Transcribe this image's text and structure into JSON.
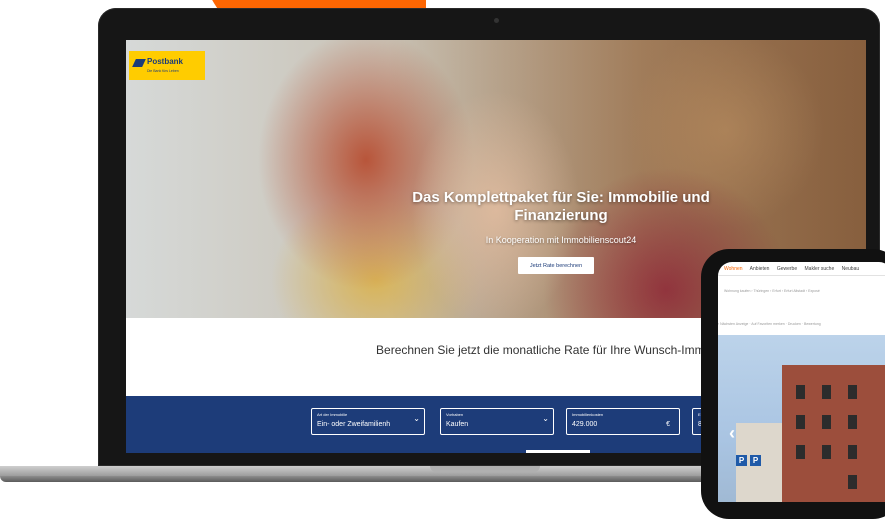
{
  "brand": {
    "name": "Postbank",
    "tagline": "Die Bank fürs Leben",
    "colors": {
      "primary": "#1d3c79",
      "yellow": "#ffcc00",
      "orange": "#fd6602"
    }
  },
  "hero": {
    "title": "Das Komplettpaket für Sie: Immobilie und Finanzierung",
    "subtitle": "In Kooperation mit Immobilienscout24",
    "cta_label": "Jetzt Rate berechnen"
  },
  "calculator": {
    "heading": "Berechnen Sie jetzt die monatliche Rate für Ihre Wunsch-Immobilie:",
    "fields": [
      {
        "label": "Art der Immobilie",
        "value": "Ein- oder Zweifamilienh",
        "icon": "chevron-down-icon"
      },
      {
        "label": "Vorhaben",
        "value": "Kaufen",
        "icon": "chevron-down-icon"
      },
      {
        "label": "Immobilienkosten",
        "value": "429.000",
        "unit": "€"
      },
      {
        "label": "E",
        "value": "8"
      }
    ]
  },
  "tablet": {
    "nav": [
      "Wohnen",
      "Anbieten",
      "Gewerbe",
      "Makler suche",
      "Neubau"
    ],
    "active_nav": "Wohnen",
    "breadcrumb": "Wohnung kaufen › Thüringen › Erfurt › Erfurt Altstadt › Exposé",
    "breadcrumb2": "‹ Nächsten Anzeige  ·  Auf Favoriten merken  ·  Drucken  ·  Bewertung",
    "parking_sign": "P",
    "gallery_prev_icon": "chevron-left-icon"
  }
}
